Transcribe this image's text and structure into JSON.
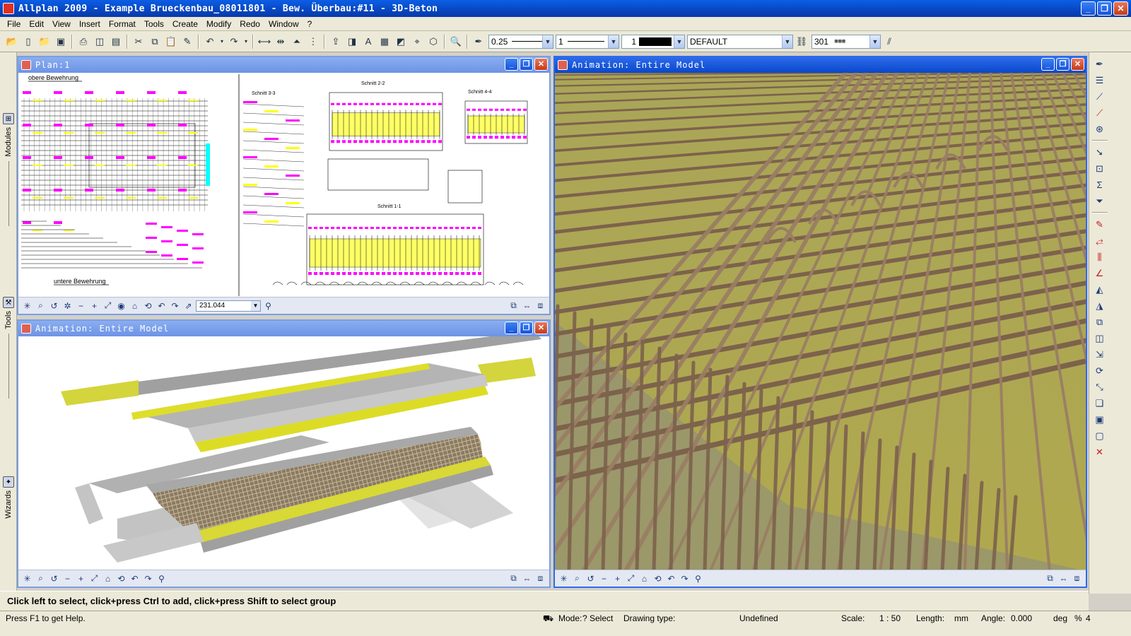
{
  "app": {
    "title": "Allplan 2009 - Example Brueckenbau_08011801 - Bew. Überbau:#11 - 3D-Beton"
  },
  "menu": [
    "File",
    "Edit",
    "View",
    "Insert",
    "Format",
    "Tools",
    "Create",
    "Modify",
    "Redo",
    "Window",
    "?"
  ],
  "toolbar": {
    "pen": "0.25",
    "line": "1",
    "color": "1",
    "layer": "DEFAULT",
    "pattern": "301"
  },
  "lefttabs": {
    "modules": "Modules",
    "tools": "Tools",
    "wizards": "Wizards"
  },
  "viewports": {
    "plan": {
      "title": "Plan:1",
      "zoom": "231.044",
      "labels": {
        "top": "obere Bewehrung",
        "bottom": "untere Bewehrung",
        "s22": "Schnitt 2-2",
        "s44": "Schnitt 4-4",
        "s33": "Schnitt 3-3",
        "s11": "Schnitt 1-1"
      }
    },
    "anim_left": {
      "title": "Animation: Entire Model"
    },
    "anim_right": {
      "title": "Animation: Entire Model"
    }
  },
  "hint": "Click left to select, click+press Ctrl to add, click+press Shift to select group",
  "status": {
    "help": "Press F1 to get Help.",
    "mode_label": "Mode:",
    "mode": "? Select",
    "drawing_type_label": "Drawing type:",
    "drawing_type": "Undefined",
    "scale_label": "Scale:",
    "scale": "1 : 50",
    "length_label": "Length:",
    "length_unit": "mm",
    "angle_label": "Angle:",
    "angle": "0.000",
    "angle_unit": "deg",
    "pct": "%",
    "num": "4"
  },
  "colors": {
    "titlebar": "#0846c0",
    "rebar": "#8a6a52",
    "concrete_yellow": "#d8d820",
    "background": "#c8c060"
  }
}
